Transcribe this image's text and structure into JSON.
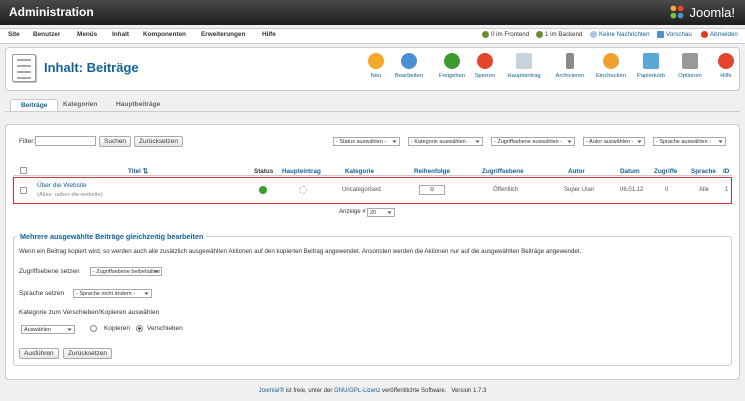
{
  "window": {
    "title": "Administration",
    "logo_text": "Joomla!"
  },
  "menu": {
    "items": [
      "Site",
      "Benutzer",
      "Menüs",
      "Inhalt",
      "Komponenten",
      "Erweiterungen",
      "Hilfe"
    ],
    "status": {
      "frontend": "0 im Frontend",
      "backend": "1 im Backend",
      "messages": "Keine Nachrichten",
      "preview": "Vorschau",
      "logout": "Abmelden"
    }
  },
  "toolbar": {
    "title": "Inhalt: Beiträge",
    "buttons": [
      "Neu",
      "Bearbeiten",
      "Freigeben",
      "Sperren",
      "Haupteintrag",
      "Archivieren",
      "Einchecken",
      "Papierkorb",
      "Optionen",
      "Hilfe"
    ]
  },
  "tabs": [
    "Beiträge",
    "Kategorien",
    "Hauptbeiträge"
  ],
  "filter": {
    "label": "Filter:",
    "value": "",
    "search_button": "Suchen",
    "reset_button": "Zurücksetzen",
    "selects": [
      "- Status auswählen -",
      "- Kategorie auswählen -",
      "- Zugriffsebene auswählen -",
      "- Autor auswählen -",
      "- Sprache auswählen -"
    ]
  },
  "table": {
    "headers": [
      "Titel",
      "Status",
      "Haupteintrag",
      "Kategorie",
      "Reihenfolge",
      "Zugriffsebene",
      "Autor",
      "Datum",
      "Zugriffe",
      "Sprache",
      "ID"
    ],
    "row": {
      "title": "Über die Website",
      "alias": "(Alias: ueber-die-website)",
      "category": "Uncategorised",
      "order": "0",
      "access": "Öffentlich",
      "author": "Super User",
      "date": "06.01.12",
      "hits": "0",
      "language": "Alle",
      "id": "1"
    },
    "display_label": "Anzeige #",
    "display_value": "20"
  },
  "batch": {
    "legend": "Mehrere ausgewählte Beiträge gleichzeitig bearbeiten",
    "description": "Wenn ein Beitrag kopiert wird, so werden auch alle zusätzlich ausgewählten Aktionen auf den kopierten Beitrag angewendet. Ansonsten werden die Aktionen nur auf die ausgewählten Beiträge angewendet.",
    "access_label": "Zugriffsebene setzen",
    "access_value": "- Zugriffsebene beibehalten -",
    "language_label": "Sprache setzen",
    "language_value": "- Sprache nicht ändern -",
    "category_label": "Kategorie zum Verschieben/Kopieren auswählen",
    "category_value": "Auswählen",
    "copy_label": "Kopieren",
    "move_label": "Verschieben",
    "submit_button": "Ausführen",
    "reset_button": "Zurücksetzen"
  },
  "footer": {
    "joomla_link": "Joomla!®",
    "text1": " ist freie, unter der ",
    "license_link": "GNU/GPL-Lizenz",
    "text2": " veröffentlichte Software.",
    "version": "Version 1.7.3"
  },
  "colors": {
    "accent": "#146295",
    "highlight_border": "#cc3333",
    "topbar": "#2b2b2b"
  }
}
